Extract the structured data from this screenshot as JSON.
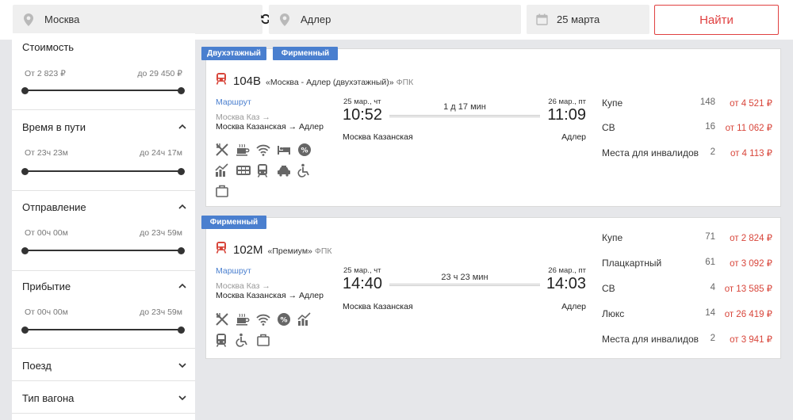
{
  "search": {
    "from": "Москва",
    "to": "Адлер",
    "date": "25 марта",
    "find_label": "Найти"
  },
  "filters": {
    "price": {
      "title": "Стоимость",
      "min": "От 2 823 ₽",
      "max": "до 29 450 ₽"
    },
    "travel_time": {
      "title": "Время в пути",
      "min": "От 23ч 23м",
      "max": "до 24ч 17м"
    },
    "departure": {
      "title": "Отправление",
      "min": "От 00ч 00м",
      "max": "до 23ч 59м"
    },
    "arrival": {
      "title": "Прибытие",
      "min": "От 00ч 00м",
      "max": "до 23ч 59м"
    },
    "train": {
      "title": "Поезд"
    },
    "car_type": {
      "title": "Тип вагона"
    }
  },
  "trains": [
    {
      "tags": [
        "Двухэтажный",
        "Фирменный"
      ],
      "number": "104В",
      "name": "«Москва - Адлер (двухэтажный)»",
      "carrier": "ФПК",
      "route_link": "Маршрут",
      "route_from": "Москва Каз →",
      "route_full": "Москва Казанская → Адлер",
      "dep_date": "25 мар., чт",
      "dep_time": "10:52",
      "arr_date": "26 мар., пт",
      "arr_time": "11:09",
      "duration": "1 д 17 мин",
      "dep_station": "Москва Казанская",
      "arr_station": "Адлер",
      "amenities": [
        "restaurant-icon",
        "coffee-icon",
        "wifi-icon",
        "bed-icon",
        "discount-icon",
        "chart-icon",
        "car-icon",
        "bus-icon",
        "taxi-icon",
        "wheelchair-icon",
        "luggage-icon"
      ],
      "classes": [
        {
          "name": "Купе",
          "seats": "148",
          "price": "от 4 521 ₽"
        },
        {
          "name": "СВ",
          "seats": "16",
          "price": "от 11 062 ₽"
        },
        {
          "name": "Места для инвалидов",
          "seats": "2",
          "price": "от 4 113 ₽"
        }
      ]
    },
    {
      "tags": [
        "Фирменный"
      ],
      "number": "102М",
      "name": "«Премиум»",
      "carrier": "ФПК",
      "route_link": "Маршрут",
      "route_from": "Москва Каз →",
      "route_full": "Москва Казанская → Адлер",
      "dep_date": "25 мар., чт",
      "dep_time": "14:40",
      "arr_date": "26 мар., пт",
      "arr_time": "14:03",
      "duration": "23 ч 23 мин",
      "dep_station": "Москва Казанская",
      "arr_station": "Адлер",
      "amenities": [
        "restaurant-icon",
        "coffee-icon",
        "wifi-icon",
        "discount-icon",
        "chart-icon",
        "bus-icon",
        "wheelchair-icon",
        "luggage-icon"
      ],
      "classes": [
        {
          "name": "Купе",
          "seats": "71",
          "price": "от 2 824 ₽"
        },
        {
          "name": "Плацкартный",
          "seats": "61",
          "price": "от 3 092 ₽"
        },
        {
          "name": "СВ",
          "seats": "4",
          "price": "от 13 585 ₽"
        },
        {
          "name": "Люкс",
          "seats": "14",
          "price": "от 26 419 ₽"
        },
        {
          "name": "Места для инвалидов",
          "seats": "2",
          "price": "от 3 941 ₽"
        }
      ]
    }
  ],
  "colors": {
    "accent": "#4a7fcf",
    "price": "#d8453a",
    "button": "#e04040",
    "train_icon": "#d8453a"
  }
}
